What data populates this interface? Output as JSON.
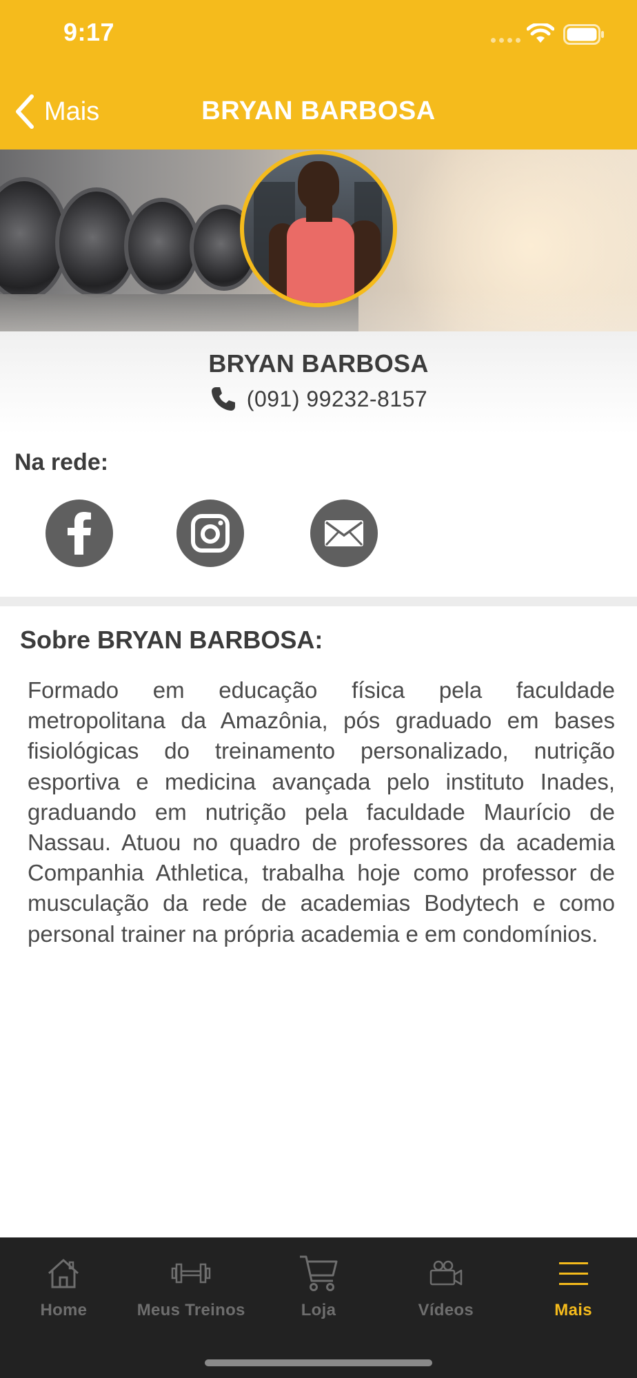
{
  "status_bar": {
    "time": "9:17"
  },
  "nav": {
    "back_label": "Mais",
    "title": "BRYAN BARBOSA"
  },
  "hero": {
    "avatar": "trainer-photo"
  },
  "profile": {
    "name": "BRYAN BARBOSA",
    "phone": "(091) 99232-8157"
  },
  "social": {
    "title": "Na rede:",
    "links": [
      {
        "icon": "facebook-icon"
      },
      {
        "icon": "instagram-icon"
      },
      {
        "icon": "email-icon"
      }
    ]
  },
  "about": {
    "title": "Sobre BRYAN BARBOSA:",
    "text": "Formado em educação física pela faculdade metropolitana da Amazônia, pós graduado em bases fisiológicas do treinamento personalizado, nutrição esportiva e medicina avançada pelo instituto Inades, graduando em nutrição pela faculdade Maurício de Nassau. Atuou no quadro de professores da academia Companhia Athletica, trabalha hoje como professor de musculação da rede de academias Bodytech e como personal trainer na própria academia e em condomínios."
  },
  "tabbar": {
    "items": [
      {
        "label": "Home",
        "icon": "home-icon"
      },
      {
        "label": "Meus Treinos",
        "icon": "dumbbell-icon"
      },
      {
        "label": "Loja",
        "icon": "cart-icon"
      },
      {
        "label": "Vídeos",
        "icon": "video-camera-icon"
      },
      {
        "label": "Mais",
        "icon": "menu-icon",
        "active": true
      }
    ]
  },
  "colors": {
    "accent": "#f5bb1c",
    "tabbar_bg": "#222222",
    "inactive": "#6e6e6e",
    "social_bg": "#5f5f5f"
  }
}
